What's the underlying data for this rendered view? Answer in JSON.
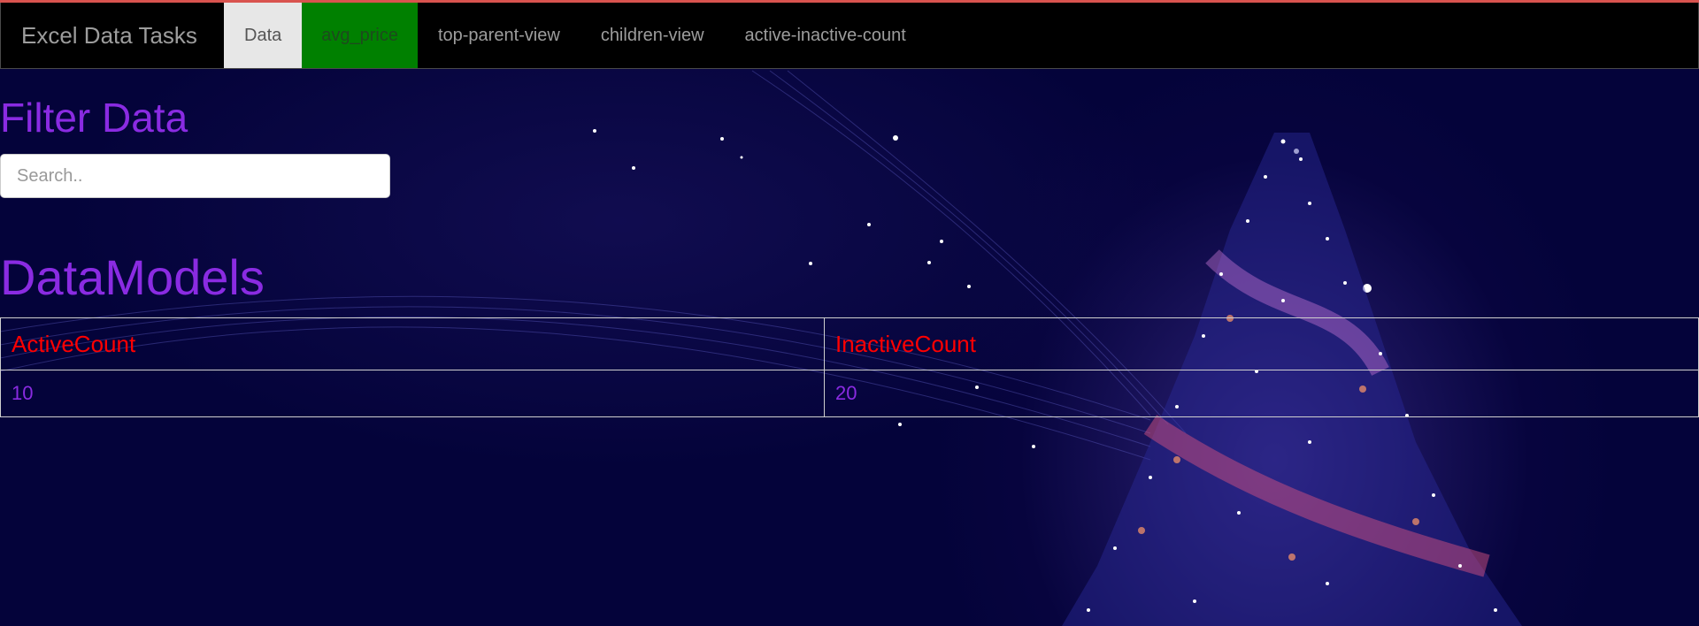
{
  "navbar": {
    "brand": "Excel Data Tasks",
    "items": [
      {
        "label": "Data",
        "state": "active"
      },
      {
        "label": "avg_price",
        "state": "highlighted"
      },
      {
        "label": "top-parent-view",
        "state": "normal"
      },
      {
        "label": "children-view",
        "state": "normal"
      },
      {
        "label": "active-inactive-count",
        "state": "normal"
      }
    ]
  },
  "filter": {
    "heading": "Filter Data",
    "search_placeholder": "Search.."
  },
  "models": {
    "heading": "DataModels",
    "columns": [
      "ActiveCount",
      "InactiveCount"
    ],
    "rows": [
      [
        "10",
        "20"
      ]
    ]
  },
  "colors": {
    "heading": "#8a2be2",
    "table_header": "#ff0000",
    "nav_active_bg": "#e7e7e7",
    "nav_highlight_bg": "#008000",
    "page_bg": "#04033a"
  },
  "background": {
    "image": "christmas-tree-sparkle-wallpaper"
  }
}
